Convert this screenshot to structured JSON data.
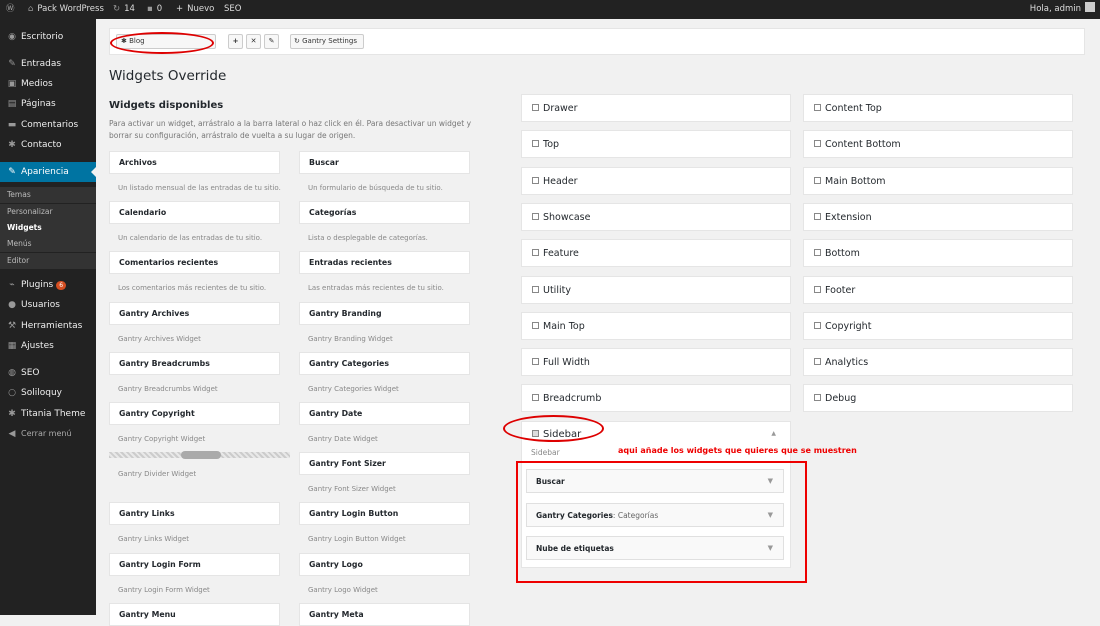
{
  "admin_bar": {
    "site_name": "Pack WordPress",
    "updates": "14",
    "comments": "0",
    "new_label": "Nuevo",
    "seo_label": "SEO",
    "greeting": "Hola, admin"
  },
  "sidebar": {
    "items": [
      {
        "label": "Escritorio",
        "icon": "dashboard-icon"
      },
      {
        "label": "Entradas",
        "icon": "pin-icon"
      },
      {
        "label": "Medios",
        "icon": "media-icon"
      },
      {
        "label": "Páginas",
        "icon": "pages-icon"
      },
      {
        "label": "Comentarios",
        "icon": "comments-icon"
      },
      {
        "label": "Contacto",
        "icon": "contact-gear-icon"
      },
      {
        "label": "Apariencia",
        "icon": "appearance-brush-icon"
      },
      {
        "label": "Plugins",
        "icon": "plugins-icon",
        "badge": "6"
      },
      {
        "label": "Usuarios",
        "icon": "users-icon"
      },
      {
        "label": "Herramientas",
        "icon": "tools-icon"
      },
      {
        "label": "Ajustes",
        "icon": "settings-icon"
      },
      {
        "label": "SEO",
        "icon": "seo-icon"
      },
      {
        "label": "Soliloquy",
        "icon": "soliloquy-icon"
      },
      {
        "label": "Titania Theme",
        "icon": "gear-icon"
      },
      {
        "label": "Cerrar menú",
        "icon": "collapse-icon"
      }
    ],
    "submenu": [
      "Temas",
      "Personalizar",
      "Widgets",
      "Menús",
      "Editor"
    ]
  },
  "toolbar": {
    "override_name": "Blog",
    "settings_label": "Gantry Settings"
  },
  "page_title": "Widgets Override",
  "available": {
    "heading": "Widgets disponibles",
    "description": "Para activar un widget, arrástralo a la barra lateral o haz click en él. Para desactivar un widget y borrar su configuración, arrástralo de vuelta a su lugar de origen."
  },
  "widgets": [
    {
      "title": "Archivos",
      "desc": "Un listado mensual de las entradas de tu sitio."
    },
    {
      "title": "Buscar",
      "desc": "Un formulario de búsqueda de tu sitio."
    },
    {
      "title": "Calendario",
      "desc": "Un calendario de las entradas de tu sitio."
    },
    {
      "title": "Categorías",
      "desc": "Lista o desplegable de categorías."
    },
    {
      "title": "Comentarios recientes",
      "desc": "Los comentarios más recientes de tu sitio."
    },
    {
      "title": "Entradas recientes",
      "desc": "Las entradas más recientes de tu sitio."
    },
    {
      "title": "Gantry Archives",
      "desc": "Gantry Archives Widget"
    },
    {
      "title": "Gantry Branding",
      "desc": "Gantry Branding Widget"
    },
    {
      "title": "Gantry Breadcrumbs",
      "desc": "Gantry Breadcrumbs Widget"
    },
    {
      "title": "Gantry Categories",
      "desc": "Gantry Categories Widget"
    },
    {
      "title": "Gantry Copyright",
      "desc": "Gantry Copyright Widget"
    },
    {
      "title": "Gantry Date",
      "desc": "Gantry Date Widget"
    },
    {
      "title": "",
      "desc": "Gantry Divider Widget"
    },
    {
      "title": "Gantry Font Sizer",
      "desc": "Gantry Font Sizer Widget"
    },
    {
      "title": "Gantry Links",
      "desc": "Gantry Links Widget"
    },
    {
      "title": "Gantry Login Button",
      "desc": "Gantry Login Button Widget"
    },
    {
      "title": "Gantry Login Form",
      "desc": "Gantry Login Form Widget"
    },
    {
      "title": "Gantry Logo",
      "desc": "Gantry Logo Widget"
    },
    {
      "title": "Gantry Menu",
      "desc": ""
    },
    {
      "title": "Gantry Meta",
      "desc": ""
    }
  ],
  "sidebars_left": [
    "Drawer",
    "Top",
    "Header",
    "Showcase",
    "Feature",
    "Utility",
    "Main Top",
    "Full Width",
    "Breadcrumb"
  ],
  "sidebars_right": [
    "Content Top",
    "Content Bottom",
    "Main Bottom",
    "Extension",
    "Bottom",
    "Footer",
    "Copyright",
    "Analytics",
    "Debug"
  ],
  "active_sidebar": {
    "title": "Sidebar",
    "sub": "Sidebar",
    "widgets": [
      {
        "name": "Buscar",
        "title": ""
      },
      {
        "name": "Gantry Categories",
        "title": ": Categorías"
      },
      {
        "name": "Nube de etiquetas",
        "title": ""
      }
    ]
  },
  "annotation": "aqui añade los widgets que quieres que se muestren",
  "colors": {
    "admin_bar": "#222222",
    "current_menu": "#0074a2",
    "annotation_red": "#ee0000",
    "badge": "#d54e21"
  }
}
